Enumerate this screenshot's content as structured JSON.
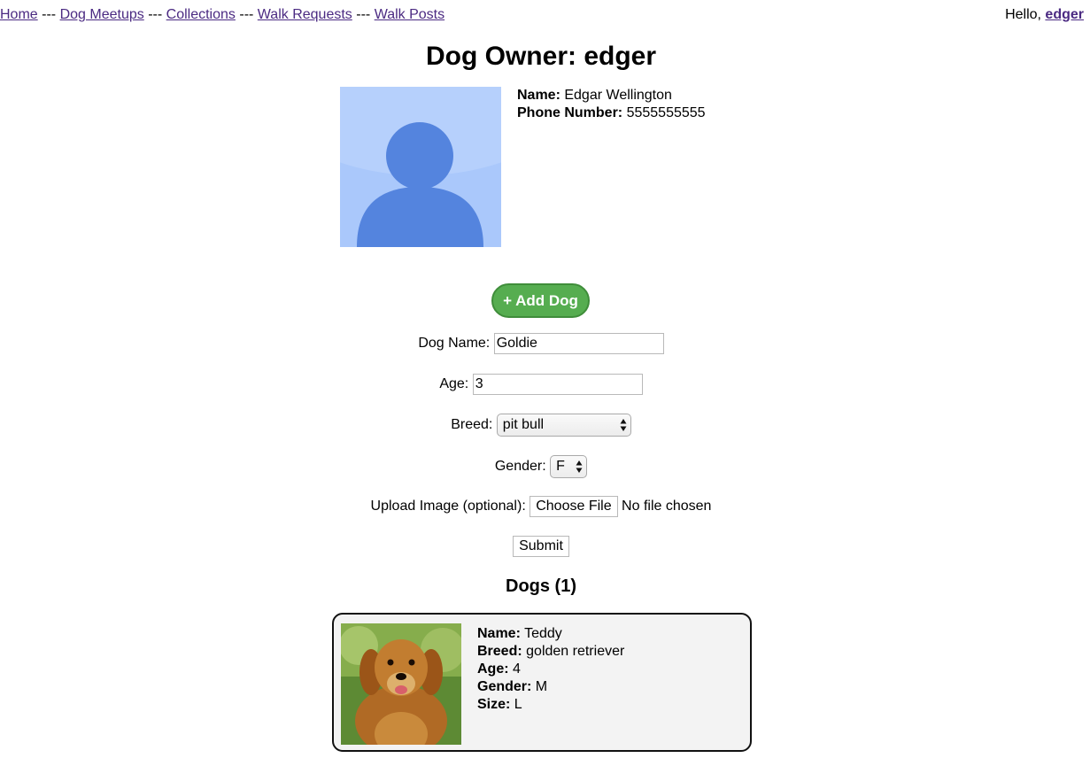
{
  "nav": {
    "links": [
      "Home",
      "Dog Meetups",
      "Collections",
      "Walk Requests",
      "Walk Posts"
    ],
    "separator": "---"
  },
  "user": {
    "greeting": "Hello,",
    "username": "edger"
  },
  "page_title": "Dog Owner: edger",
  "owner": {
    "avatar_icon": "default-person-avatar",
    "name_label": "Name:",
    "name": "Edgar Wellington",
    "phone_label": "Phone Number:",
    "phone": "5555555555"
  },
  "add_dog_button": "+ Add Dog",
  "form": {
    "dog_name_label": "Dog Name:",
    "dog_name_value": "Goldie",
    "age_label": "Age:",
    "age_value": "3",
    "breed_label": "Breed:",
    "breed_value": "pit bull",
    "gender_label": "Gender:",
    "gender_value": "F",
    "upload_label": "Upload Image (optional):",
    "choose_file_button": "Choose File",
    "file_status": "No file chosen",
    "submit_button": "Submit"
  },
  "dogs_heading": "Dogs (1)",
  "dogs": [
    {
      "photo": "golden-retriever-photo",
      "name_label": "Name:",
      "name": "Teddy",
      "breed_label": "Breed:",
      "breed": "golden retriever",
      "age_label": "Age:",
      "age": "4",
      "gender_label": "Gender:",
      "gender": "M",
      "size_label": "Size:",
      "size": "L"
    }
  ],
  "colors": {
    "link": "#4b2a82",
    "add_button": "#56ad50",
    "avatar_bg": "#aac8fb",
    "avatar_figure": "#5484de",
    "card_bg": "#f3f3f3"
  }
}
